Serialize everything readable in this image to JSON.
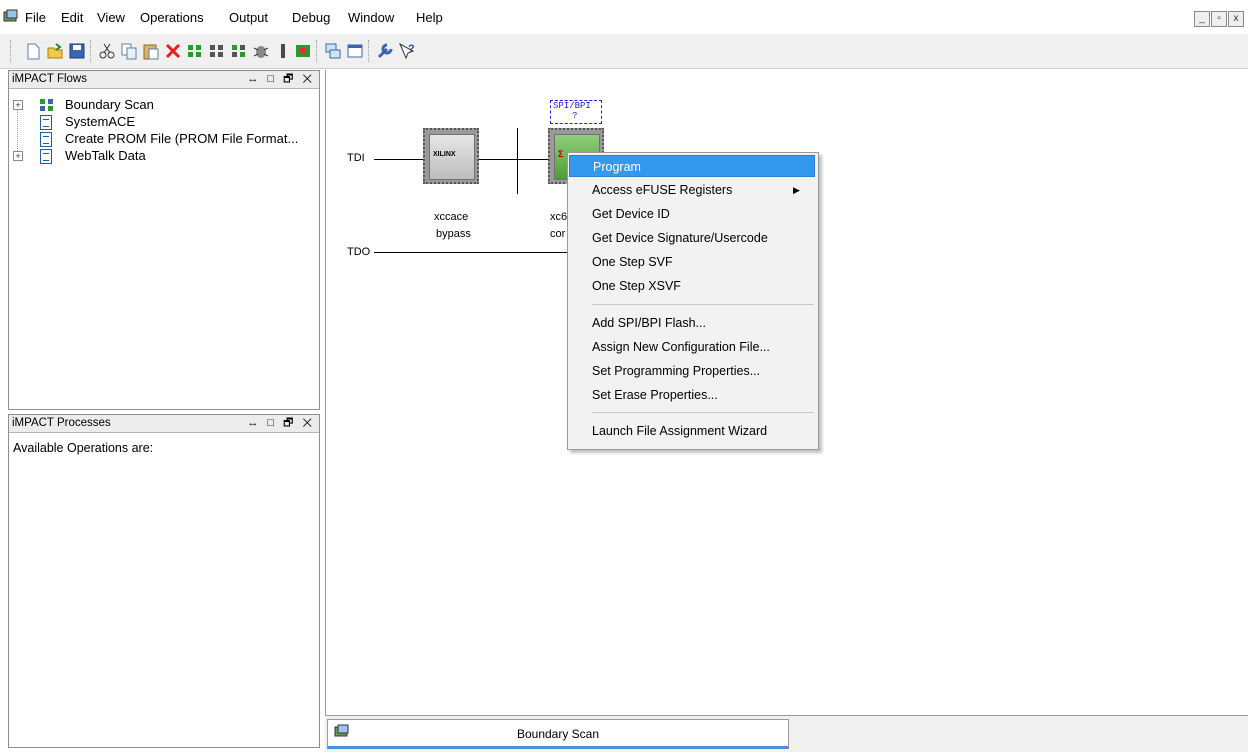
{
  "menubar": {
    "items": [
      "File",
      "Edit",
      "View",
      "Operations",
      "Output",
      "Debug",
      "Window",
      "Help"
    ]
  },
  "window_controls": [
    "_",
    "▫",
    "x"
  ],
  "toolbar": {
    "icons": [
      "new-icon",
      "open-icon",
      "save-icon",
      "cut-icon",
      "copy-icon",
      "paste-icon",
      "delete-icon",
      "initialize-chain-icon",
      "grid-icon",
      "assign-icon",
      "debug-icon",
      "chain-icon",
      "tile-icon",
      "window-icon",
      "wrench-icon",
      "help-icon"
    ]
  },
  "flows_panel": {
    "title": "iMPACT Flows",
    "controls": "↔ □ 🗗 ✕",
    "items": [
      {
        "label": "Boundary Scan",
        "expander": "+"
      },
      {
        "label": "SystemACE"
      },
      {
        "label": "Create PROM File (PROM File Format..."
      },
      {
        "label": "WebTalk Data",
        "expander": "+"
      }
    ]
  },
  "processes_panel": {
    "title": "iMPACT Processes",
    "controls": "↔ □ 🗗 ✕",
    "text": "Available Operations are:"
  },
  "canvas": {
    "tdi": "TDI",
    "tdo": "TDO",
    "spi_tag": "SPI/BPI",
    "spi_tag_sub": "?",
    "device1": {
      "name": "xccace",
      "state": "bypass",
      "logo": "XILINX"
    },
    "device2": {
      "name": "xc6",
      "state": "cor",
      "logo": "Σ"
    }
  },
  "context_menu": {
    "items": [
      {
        "label": "Program",
        "selected": true
      },
      {
        "label": "Access eFUSE Registers",
        "submenu": "▶"
      },
      {
        "label": "Get Device ID"
      },
      {
        "label": "Get Device Signature/Usercode"
      },
      {
        "label": "One Step SVF"
      },
      {
        "label": "One Step XSVF"
      },
      {
        "label": "Add SPI/BPI Flash..."
      },
      {
        "label": "Assign New Configuration File..."
      },
      {
        "label": "Set Programming Properties..."
      },
      {
        "label": "Set Erase Properties..."
      },
      {
        "label": "Launch File Assignment Wizard"
      }
    ]
  },
  "tabs": [
    {
      "label": "Boundary Scan",
      "active": true
    }
  ]
}
